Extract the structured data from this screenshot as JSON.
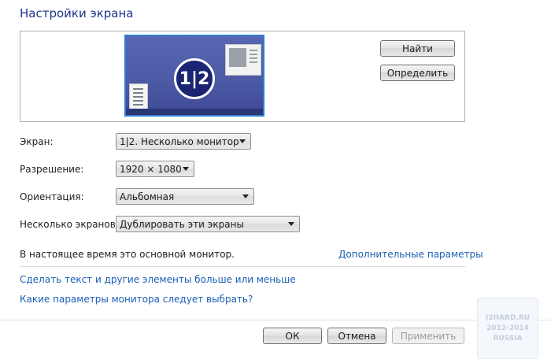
{
  "page": {
    "title": "Настройки экрана"
  },
  "preview": {
    "monitor_badge": "1|2",
    "buttons": {
      "find": "Найти",
      "identify": "Определить"
    }
  },
  "fields": {
    "screen": {
      "label": "Экран:",
      "value": "1|2. Несколько мониторов"
    },
    "resolution": {
      "label": "Разрешение:",
      "value": "1920 × 1080"
    },
    "orientation": {
      "label": "Ориентация:",
      "value": "Альбомная"
    },
    "multiple": {
      "label": "Несколько экранов:",
      "value": "Дублировать эти экраны"
    }
  },
  "status_text": "В настоящее время это основной монитор.",
  "links": {
    "advanced": "Дополнительные параметры",
    "text_size": "Сделать текст и другие элементы больше или меньше",
    "which_params": "Какие параметры монитора следует выбрать?"
  },
  "footer": {
    "ok": "ОК",
    "cancel": "Отмена",
    "apply": "Применить"
  },
  "watermark": {
    "line1": "I2HARD.RU",
    "line2": "2012-2014",
    "line3": "RUSSIA"
  },
  "colors": {
    "title": "#1e3287",
    "link": "#1a5fb4",
    "monitor_border": "#2c7fd0",
    "monitor_bg": "#4d5aa6"
  }
}
